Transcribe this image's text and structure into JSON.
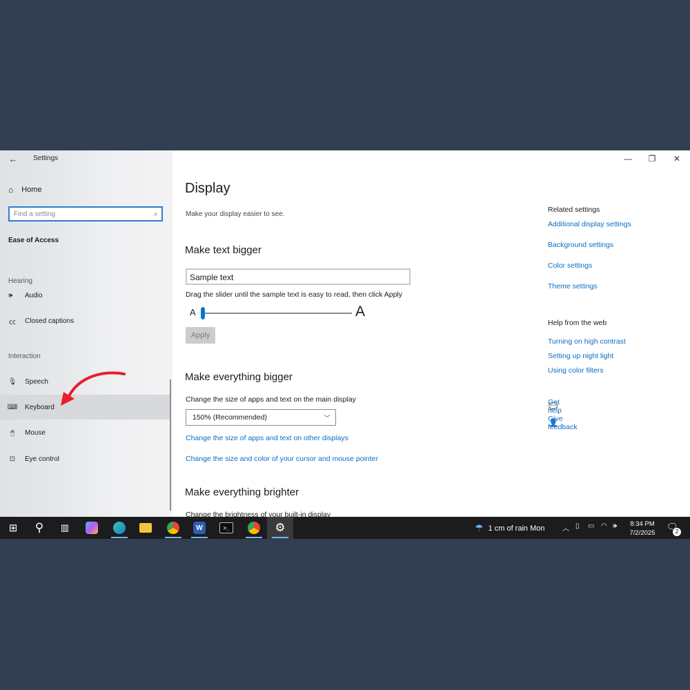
{
  "window": {
    "app_title": "Settings",
    "minimize": "—",
    "maximize": "❐",
    "close": "✕"
  },
  "sidebar": {
    "back_icon": "arrow-left-icon",
    "home_label": "Home",
    "search_placeholder": "Find a setting",
    "section_title": "Ease of Access",
    "groups": {
      "hearing": "Hearing",
      "interaction": "Interaction"
    },
    "items": {
      "audio": "Audio",
      "closed_captions": "Closed captions",
      "speech": "Speech",
      "keyboard": "Keyboard",
      "mouse": "Mouse",
      "eye_control": "Eye control"
    },
    "selected_item": "keyboard",
    "annotation_arrow_color": "#e8202a"
  },
  "main": {
    "title": "Display",
    "subtitle": "Make your display easier to see.",
    "text_bigger": {
      "heading": "Make text bigger",
      "sample_text": "Sample text",
      "slider_description": "Drag the slider until the sample text is easy to read, then click Apply",
      "slider_min_label": "A",
      "slider_max_label": "A",
      "slider_level": 0.0,
      "apply_label": "Apply"
    },
    "everything_bigger": {
      "heading": "Make everything bigger",
      "description": "Change the size of apps and text on the main display",
      "scale_value": "150% (Recommended)",
      "link_other_displays": "Change the size of apps and text on other displays",
      "link_cursor": "Change the size and color of your cursor and mouse pointer"
    },
    "brighter": {
      "heading": "Make everything brighter",
      "description": "Change the brightness of your built-in display"
    }
  },
  "related": {
    "heading": "Related settings",
    "links": {
      "additional_display": "Additional display settings",
      "background": "Background settings",
      "color": "Color settings",
      "theme": "Theme settings"
    },
    "help_heading": "Help from the web",
    "help_links": {
      "high_contrast": "Turning on high contrast",
      "night_light": "Setting up night light",
      "color_filters": "Using color filters"
    },
    "get_help": "Get help",
    "give_feedback": "Give feedback"
  },
  "taskbar": {
    "weather": "1 cm of rain Mon",
    "time": "8:34 PM",
    "date": "7/2/2025",
    "notification_count": "2",
    "accent": "#76b9ed"
  }
}
